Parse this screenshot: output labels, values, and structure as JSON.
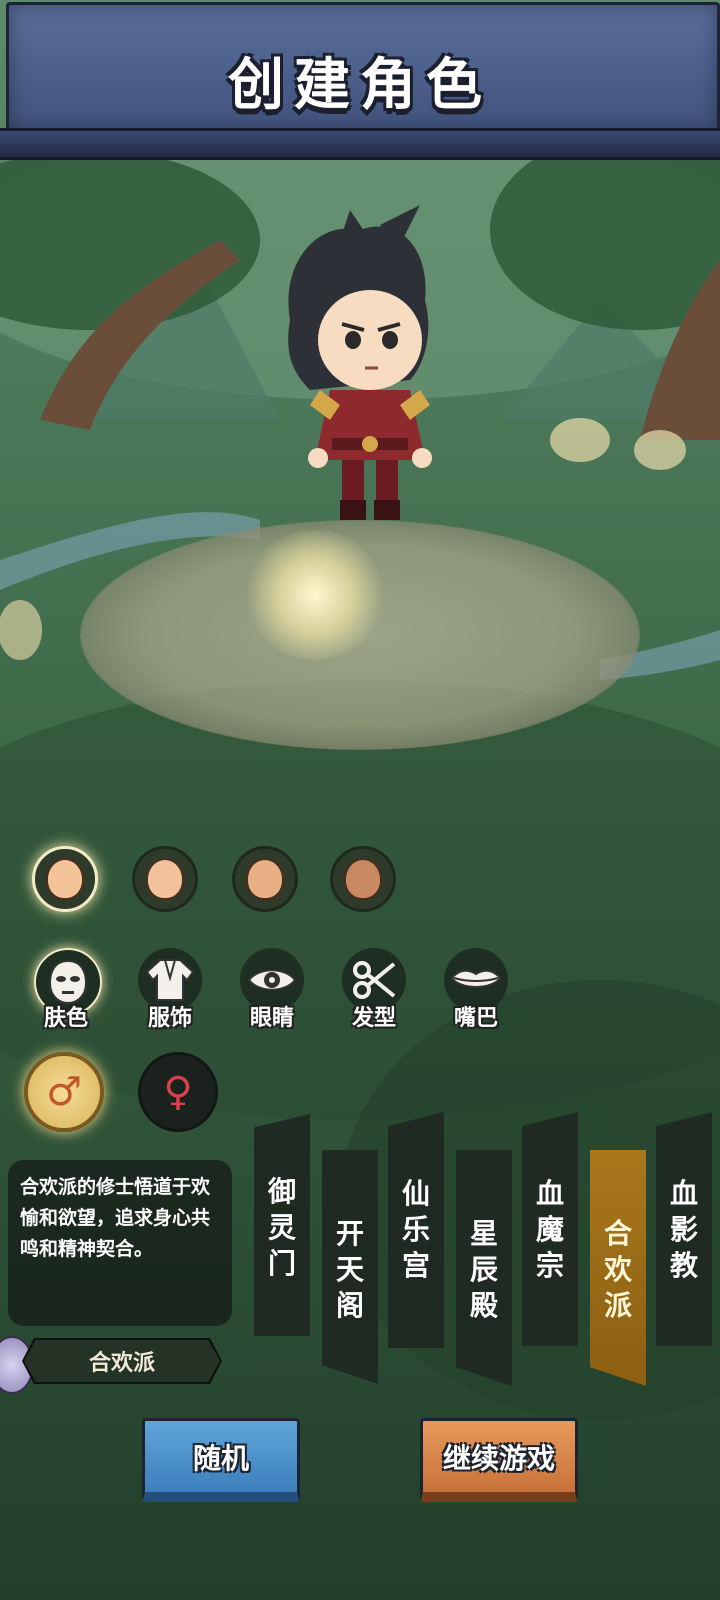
{
  "header": {
    "title": "创建角色"
  },
  "skin_tones": [
    {
      "color": "#f5c39a",
      "selected": true
    },
    {
      "color": "#f2c29c",
      "selected": false
    },
    {
      "color": "#e8b183",
      "selected": false
    },
    {
      "color": "#c98a63",
      "selected": false
    }
  ],
  "categories": [
    {
      "label": "肤色",
      "icon": "face-mask-icon"
    },
    {
      "label": "服饰",
      "icon": "robe-icon"
    },
    {
      "label": "眼睛",
      "icon": "eye-icon"
    },
    {
      "label": "发型",
      "icon": "scissors-icon"
    },
    {
      "label": "嘴巴",
      "icon": "lips-icon"
    }
  ],
  "gender": {
    "male": {
      "symbol": "♂",
      "selected": true
    },
    "female": {
      "symbol": "♀",
      "selected": false
    }
  },
  "sect_description": "合欢派的修士悟道于欢愉和欲望，追求身心共鸣和精神契合。",
  "selected_sect": "合欢派",
  "sects": [
    {
      "name": "御灵门",
      "chars": [
        "御",
        "灵",
        "门"
      ],
      "selected": false
    },
    {
      "name": "开天阁",
      "chars": [
        "开",
        "天",
        "阁"
      ],
      "selected": false
    },
    {
      "name": "仙乐宫",
      "chars": [
        "仙",
        "乐",
        "宫"
      ],
      "selected": false
    },
    {
      "name": "星辰殿",
      "chars": [
        "星",
        "辰",
        "殿"
      ],
      "selected": false
    },
    {
      "name": "血魔宗",
      "chars": [
        "血",
        "魔",
        "宗"
      ],
      "selected": false
    },
    {
      "name": "合欢派",
      "chars": [
        "合",
        "欢",
        "派"
      ],
      "selected": true
    },
    {
      "name": "血影教",
      "chars": [
        "血",
        "影",
        "教"
      ],
      "selected": false
    }
  ],
  "buttons": {
    "random": "随机",
    "continue": "继续游戏"
  },
  "colors": {
    "accent_gold": "#a8781c",
    "button_blue": "#4a8fcb",
    "button_orange": "#d9854a",
    "header_blue": "#4a5c88"
  }
}
